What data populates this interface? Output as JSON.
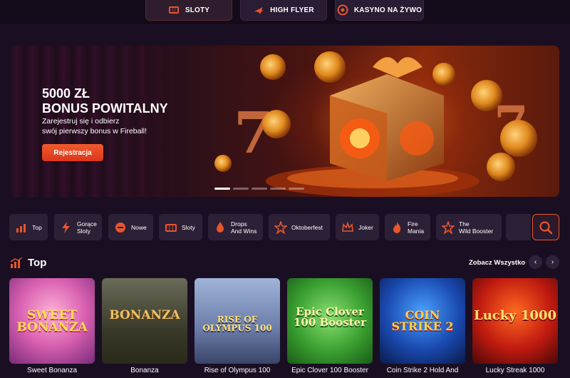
{
  "colors": {
    "background": "#1a0f22",
    "accent": "#e8552c",
    "card_bg": "#2c2036"
  },
  "topnav": {
    "tabs": [
      {
        "label": "SLOTY",
        "icon": "slot-machine-icon",
        "active": true
      },
      {
        "label": "HIGH FLYER",
        "icon": "plane-icon",
        "active": false
      },
      {
        "label": "KASYNO NA ŻYWO",
        "icon": "roulette-icon",
        "active": false
      }
    ]
  },
  "hero": {
    "title_line1": "5000 ZŁ",
    "title_line2": "BONUS POWITALNY",
    "subtitle_line1": "Zarejestruj się i odbierz",
    "subtitle_line2": "swój pierwszy bonus w Fireball!",
    "button": "Rejestracja",
    "slides": 5,
    "active_slide": 1
  },
  "categories": [
    {
      "line1": "Top",
      "line2": "",
      "icon": "chart-icon"
    },
    {
      "line1": "Gorące",
      "line2": "Sloty",
      "icon": "lightning-icon"
    },
    {
      "line1": "Nowe",
      "line2": "",
      "icon": "new-badge-icon"
    },
    {
      "line1": "Sloty",
      "line2": "",
      "icon": "slot-machine-icon"
    },
    {
      "line1": "Drops",
      "line2": "And Wins",
      "icon": "drops-icon"
    },
    {
      "line1": "Oktoberfest",
      "line2": "",
      "icon": "star-icon"
    },
    {
      "line1": "Joker",
      "line2": "",
      "icon": "crown-icon"
    },
    {
      "line1": "Fire",
      "line2": "Mania",
      "icon": "fire-icon"
    },
    {
      "line1": "The",
      "line2": "Wild Booster",
      "icon": "star-icon"
    }
  ],
  "search": {
    "icon": "search-icon"
  },
  "section": {
    "title": "Top",
    "see_all": "Zobacz Wszystko",
    "prev": "‹",
    "next": "›"
  },
  "games": [
    {
      "name": "Sweet Bonanza",
      "logo": "SWEET BONANZA"
    },
    {
      "name": "Bonanza",
      "logo": "BONANZA"
    },
    {
      "name": "Rise of Olympus 100",
      "logo": "RISE OF OLYMPUS 100"
    },
    {
      "name": "Epic Clover 100 Booster",
      "logo": "Epic Clover 100 Booster"
    },
    {
      "name": "Coin Strike 2 Hold And",
      "logo": "COIN STRIKE 2"
    },
    {
      "name": "Lucky Streak 1000",
      "logo": "Lucky 1000"
    }
  ]
}
